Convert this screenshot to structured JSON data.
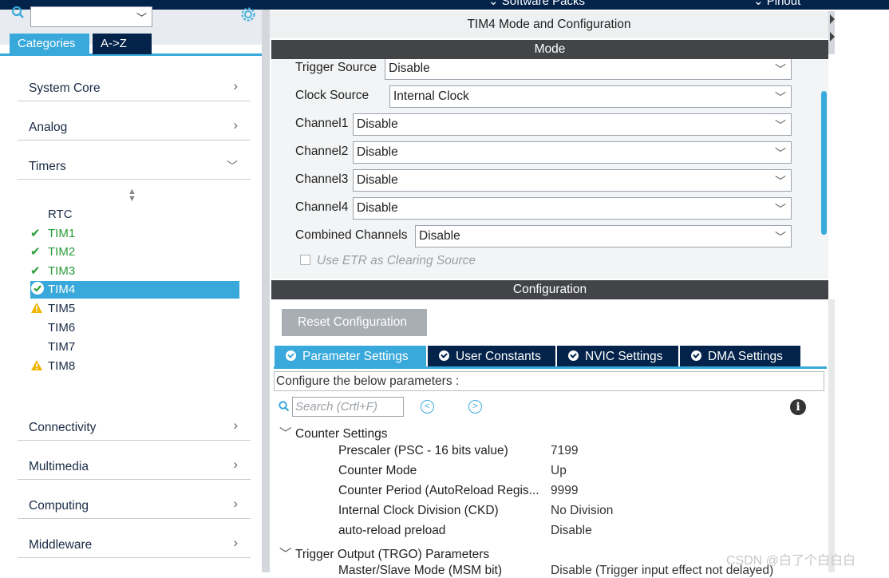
{
  "top": {
    "left_stub": "Software Packs",
    "right_stub": "Pinout"
  },
  "sidebar": {
    "tabs": [
      "Categories",
      "A->Z"
    ],
    "categories": [
      {
        "label": "System Core",
        "expanded": false
      },
      {
        "label": "Analog",
        "expanded": false
      },
      {
        "label": "Timers",
        "expanded": true
      },
      {
        "label": "Connectivity",
        "expanded": false
      },
      {
        "label": "Multimedia",
        "expanded": false
      },
      {
        "label": "Computing",
        "expanded": false
      },
      {
        "label": "Middleware",
        "expanded": false
      }
    ],
    "timers": [
      {
        "label": "RTC",
        "status": "none"
      },
      {
        "label": "TIM1",
        "status": "ok"
      },
      {
        "label": "TIM2",
        "status": "ok"
      },
      {
        "label": "TIM3",
        "status": "ok"
      },
      {
        "label": "TIM4",
        "status": "selected"
      },
      {
        "label": "TIM5",
        "status": "warning"
      },
      {
        "label": "TIM6",
        "status": "none"
      },
      {
        "label": "TIM7",
        "status": "none"
      },
      {
        "label": "TIM8",
        "status": "warning"
      }
    ]
  },
  "panel": {
    "title": "TIM4 Mode and Configuration",
    "mode_header": "Mode",
    "config_header": "Configuration",
    "mode_fields": [
      {
        "label": "Trigger Source",
        "value": "Disable"
      },
      {
        "label": "Clock Source",
        "value": "Internal Clock"
      },
      {
        "label": "Channel1",
        "value": "Disable"
      },
      {
        "label": "Channel2",
        "value": "Disable"
      },
      {
        "label": "Channel3",
        "value": "Disable"
      },
      {
        "label": "Channel4",
        "value": "Disable"
      },
      {
        "label": "Combined Channels",
        "value": "Disable"
      }
    ],
    "etr_label": "Use ETR as Clearing Source",
    "reset_label": "Reset Configuration",
    "config_tabs": [
      "Parameter Settings",
      "User Constants",
      "NVIC Settings",
      "DMA Settings"
    ],
    "hint": "Configure the below parameters :",
    "search_placeholder": "Search (Crtl+F)",
    "groups": [
      {
        "title": "Counter Settings",
        "params": [
          {
            "name": "Prescaler (PSC - 16 bits value)",
            "value": "7199"
          },
          {
            "name": "Counter Mode",
            "value": "Up"
          },
          {
            "name": "Counter Period (AutoReload Regis...",
            "value": "9999"
          },
          {
            "name": "Internal Clock Division (CKD)",
            "value": "No Division"
          },
          {
            "name": "auto-reload preload",
            "value": "Disable"
          }
        ]
      },
      {
        "title": "Trigger Output (TRGO) Parameters",
        "params": [
          {
            "name": "Master/Slave Mode (MSM bit)",
            "value": "Disable (Trigger input effect not delayed)"
          }
        ]
      }
    ]
  },
  "watermark": "CSDN @白了个白白白",
  "colors": {
    "accent": "#39a9db",
    "navy": "#03234b",
    "ok": "#2a9d3a",
    "warn": "#f0b400",
    "header": "#424448"
  }
}
